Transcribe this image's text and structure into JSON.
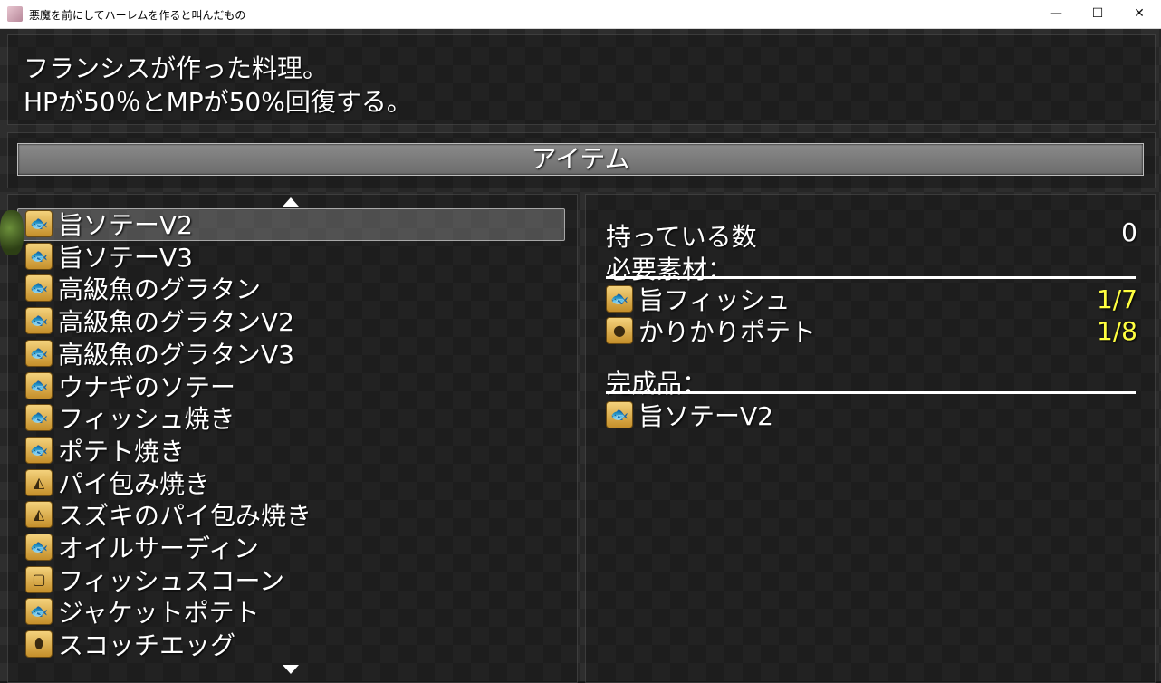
{
  "window": {
    "title": "悪魔を前にしてハーレムを作ると叫んだもの",
    "buttons": {
      "minimize": "—",
      "maximize": "☐",
      "close": "✕"
    }
  },
  "help": {
    "line1": "フランシスが作った料理。",
    "line2": "HPが50％とMPが50%回復する。"
  },
  "category": {
    "label": "アイテム"
  },
  "items": [
    {
      "name": "旨ソテーV2",
      "icon": "fish-icon",
      "glyph": "🐟"
    },
    {
      "name": "旨ソテーV3",
      "icon": "fish-icon",
      "glyph": "🐟"
    },
    {
      "name": "高級魚のグラタン",
      "icon": "fish-icon",
      "glyph": "🐟"
    },
    {
      "name": "高級魚のグラタンV2",
      "icon": "fish-icon",
      "glyph": "🐟"
    },
    {
      "name": "高級魚のグラタンV3",
      "icon": "fish-icon",
      "glyph": "🐟"
    },
    {
      "name": "ウナギのソテー",
      "icon": "fish-icon",
      "glyph": "🐟"
    },
    {
      "name": "フィッシュ焼き",
      "icon": "fish-icon",
      "glyph": "🐟"
    },
    {
      "name": "ポテト焼き",
      "icon": "fish-icon",
      "glyph": "🐟"
    },
    {
      "name": "パイ包み焼き",
      "icon": "pie-icon",
      "glyph": "◭"
    },
    {
      "name": "スズキのパイ包み焼き",
      "icon": "pie-icon",
      "glyph": "◭"
    },
    {
      "name": "オイルサーディン",
      "icon": "fish-icon",
      "glyph": "🐟"
    },
    {
      "name": "フィッシュスコーン",
      "icon": "bread-icon",
      "glyph": "▢"
    },
    {
      "name": "ジャケットポテト",
      "icon": "fish-icon",
      "glyph": "🐟"
    },
    {
      "name": "スコッチエッグ",
      "icon": "egg-icon",
      "glyph": "⬮"
    }
  ],
  "detail": {
    "owned_label": "持っている数",
    "owned_value": "0",
    "materials_label": "必要素材：",
    "materials": [
      {
        "name": "旨フィッシュ",
        "count": "1/7",
        "icon": "fish-icon",
        "glyph": "🐟"
      },
      {
        "name": "かりかりポテト",
        "count": "1/8",
        "icon": "potato-icon",
        "glyph": "●"
      }
    ],
    "product_label": "完成品：",
    "product": {
      "name": "旨ソテーV2",
      "icon": "fish-icon",
      "glyph": "🐟"
    }
  },
  "colors": {
    "count_yellow": "#ffff40",
    "text": "#ffffff"
  }
}
